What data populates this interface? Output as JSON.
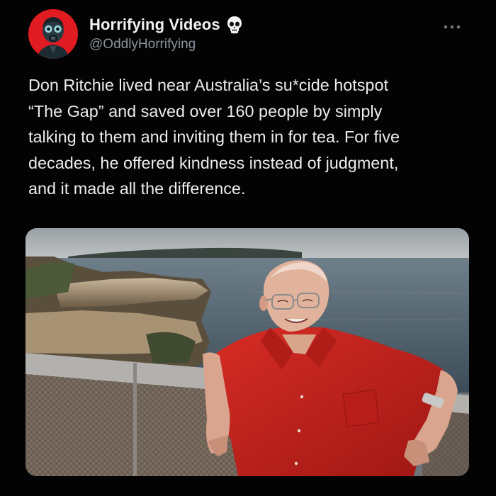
{
  "author": {
    "display_name": "Horrifying Videos",
    "handle": "@OddlyHorrifying",
    "avatar_icon": "gas-mask-icon",
    "badge_icon": "skull-icon"
  },
  "menu": {
    "icon": "more-horizontal-icon"
  },
  "tweet": {
    "text_lines": [
      "Don Ritchie lived near Australia’s su*cide hotspot",
      "“The Gap” and saved over 160 people by simply",
      "talking to them and inviting them in for tea. For five",
      "decades, he offered kindness instead of judgment,",
      "and it made all the difference."
    ]
  },
  "colors": {
    "background": "#030303",
    "avatar_red": "#e01b22",
    "shirt_red": "#c8231f",
    "handle_gray": "#8b949c"
  }
}
